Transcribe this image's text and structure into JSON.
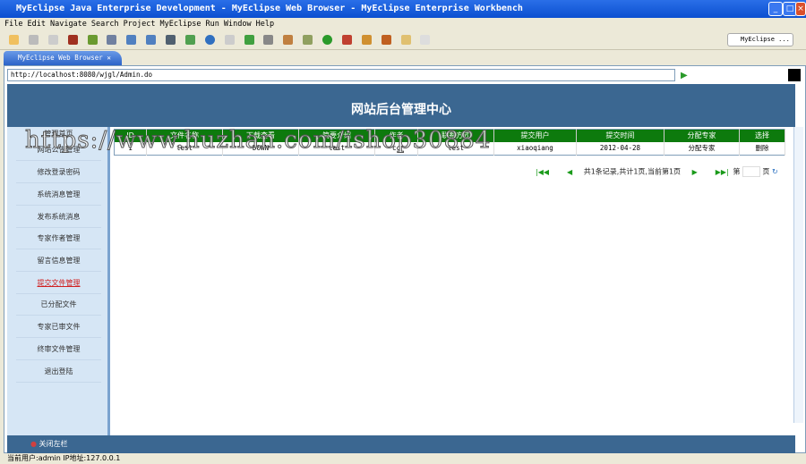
{
  "window": {
    "title": "MyEclipse Java Enterprise Development - MyEclipse Web Browser - MyEclipse Enterprise Workbench"
  },
  "menu": [
    "File",
    "Edit",
    "Navigate",
    "Search",
    "Project",
    "MyEclipse",
    "Run",
    "Window",
    "Help"
  ],
  "perspective": "MyEclipse ...",
  "tab": {
    "label": "MyEclipse Web Browser"
  },
  "browser": {
    "url": "http://localhost:8080/wjgl/Admin.do"
  },
  "page": {
    "title": "网站后台管理中心",
    "sidebar": {
      "home": "管理首页",
      "items": [
        "网站公告管理",
        "修改登录密码",
        "系统消息管理",
        "发布系统消息",
        "专家作者管理",
        "留言信息管理",
        "提交文件管理",
        "已分配文件",
        "专家已审文件",
        "终审文件管理",
        "退出登陆"
      ],
      "active": "提交文件管理"
    },
    "table": {
      "headers": [
        "ID",
        "文件名称",
        "下载查看",
        "简要介绍",
        "作者",
        "联系方式",
        "提交用户",
        "提交时间",
        "分配专家",
        "选择"
      ],
      "rows": [
        [
          "1",
          "test",
          "DOWN",
          "test",
          "cc",
          "test",
          "xiaoqiang",
          "2012-04-28",
          "分配专家",
          "删除"
        ]
      ]
    },
    "pager": {
      "summary": "共1条记录,共计1页,当前第1页",
      "page_prefix": "第",
      "page_suffix": "页"
    },
    "bottom": "关闭左栏"
  },
  "watermark": "https://www.huzhan.com/ishop30884",
  "status": "当前用户:admin  IP地址:127.0.0.1"
}
